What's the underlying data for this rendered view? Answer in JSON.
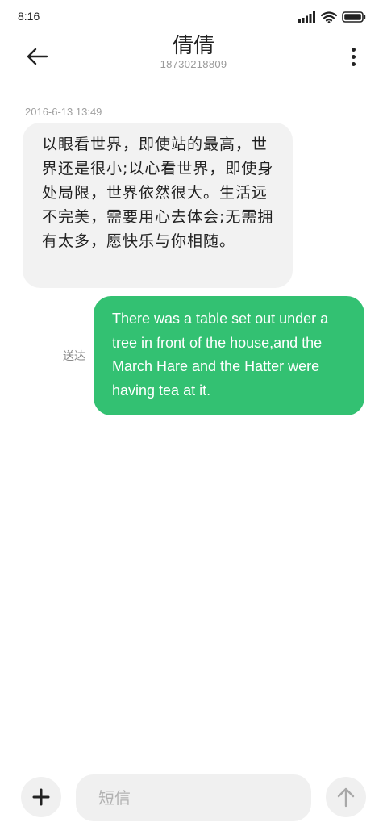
{
  "status_bar": {
    "time": "8:16",
    "icons": [
      "signal-icon",
      "wifi-icon",
      "battery-icon"
    ]
  },
  "header": {
    "back_icon": "arrow-left-icon",
    "contact_name": "倩倩",
    "contact_number": "18730218809",
    "more_icon": "more-vertical-icon"
  },
  "conversation": {
    "timestamp": "2016-6-13 13:49",
    "messages": [
      {
        "direction": "incoming",
        "text": "以眼看世界，即使站的最高，世界还是很小;以心看世界，即使身处局限，世界依然很大。生活远不完美，需要用心去体会;无需拥有太多，愿快乐与你相随。"
      },
      {
        "direction": "outgoing",
        "text": "There was a table set out under a tree in front of the house,and the March Hare and the Hatter were having tea at it.",
        "status": "送达"
      }
    ]
  },
  "composer": {
    "add_icon": "plus-icon",
    "placeholder": "短信",
    "value": "",
    "send_icon": "arrow-up-icon"
  },
  "colors": {
    "outgoing_bubble": "#33c172",
    "incoming_bubble": "#f2f2f2",
    "background": "#ffffff"
  }
}
